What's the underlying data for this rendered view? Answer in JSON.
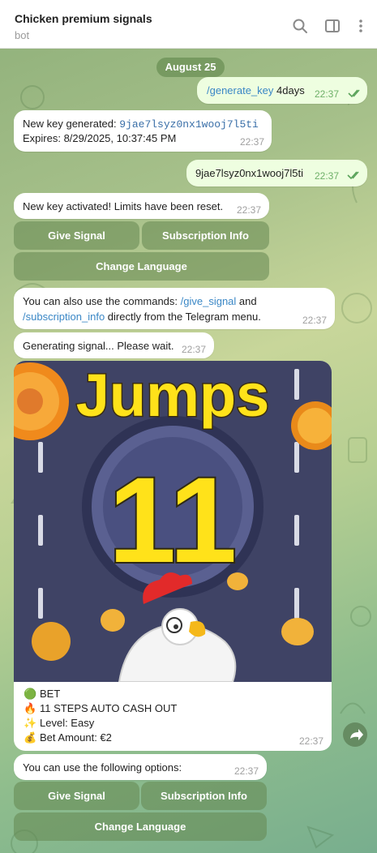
{
  "header": {
    "title": "Chicken premium signals",
    "subtitle": "bot",
    "icons": [
      "search-icon",
      "sidebar-toggle-icon",
      "more-vert-icon"
    ]
  },
  "date_label": "August 25",
  "messages": {
    "cmd": {
      "command": "/generate_key",
      "arg": " 4days",
      "time": "22:37"
    },
    "keygen": {
      "line1": "New key generated: ",
      "key": "9jae7lsyz0nx1wooj7l5ti",
      "line2": "Expires: 8/29/2025, 10:37:45 PM",
      "time": "22:37"
    },
    "keysent": {
      "text": "9jae7lsyz0nx1wooj7l5ti",
      "time": "22:37"
    },
    "activated": {
      "text": "New key activated! Limits have been reset.",
      "time": "22:37"
    },
    "commands": {
      "pre": "You can also use the commands: ",
      "cmd1": "/give_signal",
      "mid": " and",
      "cmd2": "/subscription_info",
      "post": " directly from the Telegram menu.",
      "time": "22:37"
    },
    "generating": {
      "text": "Generating signal... Please wait.",
      "time": "22:37"
    },
    "signal": {
      "poster_title": "Jumps",
      "poster_number": "11",
      "lines": [
        {
          "emoji": "🟢",
          "text": "BET"
        },
        {
          "emoji": "🔥",
          "text": "11 STEPS AUTO CASH OUT"
        },
        {
          "emoji": "✨",
          "text": "Level: Easy"
        },
        {
          "emoji": "💰",
          "text": "Bet Amount: €2"
        }
      ],
      "time": "22:37"
    },
    "options": {
      "text": "You can use the following options:",
      "time": "22:37"
    }
  },
  "keyboard1": {
    "give_signal": "Give Signal",
    "subscription_info": "Subscription Info",
    "change_language": "Change Language"
  },
  "keyboard2": {
    "give_signal": "Give Signal",
    "subscription_info": "Subscription Info",
    "change_language": "Change Language"
  },
  "colors": {
    "accent_link": "#3a87c6",
    "out_bubble": "#eefee0",
    "poster_bg": "#3f4365",
    "jumps_yellow": "#ffe21a"
  }
}
